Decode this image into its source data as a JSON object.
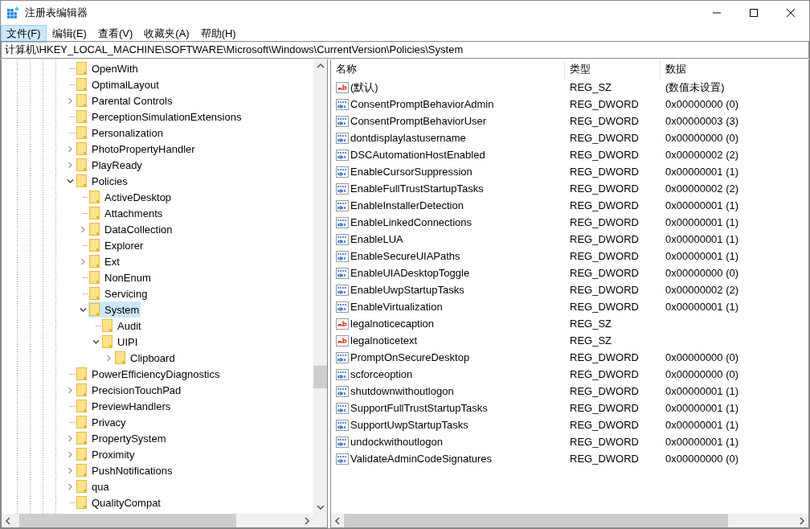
{
  "window": {
    "title": "注册表编辑器"
  },
  "menu": [
    {
      "label": "文件(F)",
      "selected": true
    },
    {
      "label": "编辑(E)",
      "selected": false
    },
    {
      "label": "查看(V)",
      "selected": false
    },
    {
      "label": "收藏夹(A)",
      "selected": false
    },
    {
      "label": "帮助(H)",
      "selected": false
    }
  ],
  "address": "计算机\\HKEY_LOCAL_MACHINE\\SOFTWARE\\Microsoft\\Windows\\CurrentVersion\\Policies\\System",
  "tree": [
    {
      "label": "OpenWith",
      "selected": false
    },
    {
      "label": "OptimalLayout",
      "selected": false
    },
    {
      "label": "Parental Controls",
      "expanded": false,
      "selected": false
    },
    {
      "label": "PerceptionSimulationExtensions",
      "selected": false
    },
    {
      "label": "Personalization",
      "selected": false
    },
    {
      "label": "PhotoPropertyHandler",
      "expanded": false,
      "selected": false
    },
    {
      "label": "PlayReady",
      "expanded": false,
      "selected": false
    },
    {
      "label": "Policies",
      "expanded": true,
      "selected": false,
      "children": [
        {
          "label": "ActiveDesktop",
          "selected": false
        },
        {
          "label": "Attachments",
          "selected": false
        },
        {
          "label": "DataCollection",
          "expanded": false,
          "selected": false
        },
        {
          "label": "Explorer",
          "selected": false
        },
        {
          "label": "Ext",
          "expanded": false,
          "selected": false
        },
        {
          "label": "NonEnum",
          "selected": false
        },
        {
          "label": "Servicing",
          "selected": false
        },
        {
          "label": "System",
          "expanded": true,
          "selected": true,
          "children": [
            {
              "label": "Audit",
              "selected": false
            },
            {
              "label": "UIPI",
              "expanded": true,
              "selected": false,
              "children": [
                {
                  "label": "Clipboard",
                  "expanded": false,
                  "selected": false
                }
              ]
            }
          ]
        }
      ]
    },
    {
      "label": "PowerEfficiencyDiagnostics",
      "selected": false
    },
    {
      "label": "PrecisionTouchPad",
      "expanded": false,
      "selected": false
    },
    {
      "label": "PreviewHandlers",
      "selected": false
    },
    {
      "label": "Privacy",
      "selected": false
    },
    {
      "label": "PropertySystem",
      "expanded": false,
      "selected": false
    },
    {
      "label": "Proximity",
      "expanded": false,
      "selected": false
    },
    {
      "label": "PushNotifications",
      "expanded": false,
      "selected": false
    },
    {
      "label": "qua",
      "expanded": false,
      "selected": false
    },
    {
      "label": "QualityCompat",
      "selected": false
    }
  ],
  "table": {
    "columns": [
      "名称",
      "类型",
      "数据"
    ],
    "rows": [
      {
        "kind": "string",
        "name": "(默认)",
        "type": "REG_SZ",
        "data": "(数值未设置)"
      },
      {
        "kind": "binary",
        "name": "ConsentPromptBehaviorAdmin",
        "type": "REG_DWORD",
        "data": "0x00000000 (0)"
      },
      {
        "kind": "binary",
        "name": "ConsentPromptBehaviorUser",
        "type": "REG_DWORD",
        "data": "0x00000003 (3)"
      },
      {
        "kind": "binary",
        "name": "dontdisplaylastusername",
        "type": "REG_DWORD",
        "data": "0x00000000 (0)"
      },
      {
        "kind": "binary",
        "name": "DSCAutomationHostEnabled",
        "type": "REG_DWORD",
        "data": "0x00000002 (2)"
      },
      {
        "kind": "binary",
        "name": "EnableCursorSuppression",
        "type": "REG_DWORD",
        "data": "0x00000001 (1)"
      },
      {
        "kind": "binary",
        "name": "EnableFullTrustStartupTasks",
        "type": "REG_DWORD",
        "data": "0x00000002 (2)"
      },
      {
        "kind": "binary",
        "name": "EnableInstallerDetection",
        "type": "REG_DWORD",
        "data": "0x00000001 (1)"
      },
      {
        "kind": "binary",
        "name": "EnableLinkedConnections",
        "type": "REG_DWORD",
        "data": "0x00000001 (1)"
      },
      {
        "kind": "binary",
        "name": "EnableLUA",
        "type": "REG_DWORD",
        "data": "0x00000001 (1)"
      },
      {
        "kind": "binary",
        "name": "EnableSecureUIAPaths",
        "type": "REG_DWORD",
        "data": "0x00000001 (1)"
      },
      {
        "kind": "binary",
        "name": "EnableUIADesktopToggle",
        "type": "REG_DWORD",
        "data": "0x00000000 (0)"
      },
      {
        "kind": "binary",
        "name": "EnableUwpStartupTasks",
        "type": "REG_DWORD",
        "data": "0x00000002 (2)"
      },
      {
        "kind": "binary",
        "name": "EnableVirtualization",
        "type": "REG_DWORD",
        "data": "0x00000001 (1)"
      },
      {
        "kind": "string",
        "name": "legalnoticecaption",
        "type": "REG_SZ"
      },
      {
        "kind": "string",
        "name": "legalnoticetext",
        "type": "REG_SZ"
      },
      {
        "kind": "binary",
        "name": "PromptOnSecureDesktop",
        "type": "REG_DWORD",
        "data": "0x00000000 (0)"
      },
      {
        "kind": "binary",
        "name": "scforceoption",
        "type": "REG_DWORD",
        "data": "0x00000000 (0)"
      },
      {
        "kind": "binary",
        "name": "shutdownwithoutlogon",
        "type": "REG_DWORD",
        "data": "0x00000001 (1)"
      },
      {
        "kind": "binary",
        "name": "SupportFullTrustStartupTasks",
        "type": "REG_DWORD",
        "data": "0x00000001 (1)"
      },
      {
        "kind": "binary",
        "name": "SupportUwpStartupTasks",
        "type": "REG_DWORD",
        "data": "0x00000001 (1)"
      },
      {
        "kind": "binary",
        "name": "undockwithoutlogon",
        "type": "REG_DWORD",
        "data": "0x00000001 (1)"
      },
      {
        "kind": "binary",
        "name": "ValidateAdminCodeSignatures",
        "type": "REG_DWORD",
        "data": "0x00000000 (0)"
      }
    ]
  }
}
